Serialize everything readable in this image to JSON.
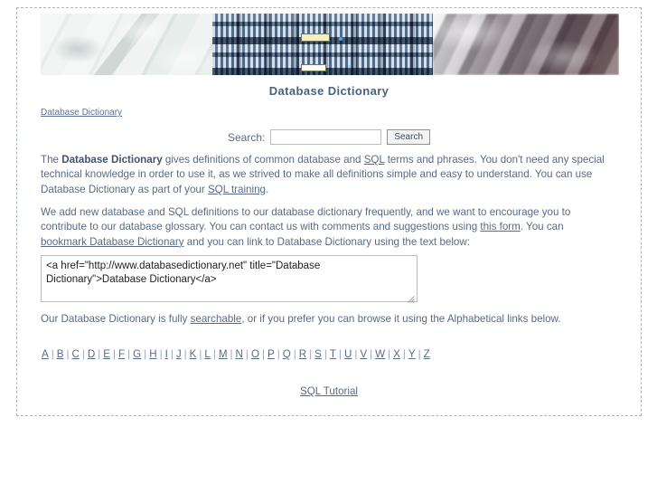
{
  "page": {
    "title": "Database Dictionary",
    "breadcrumb_label": "Database Dictionary"
  },
  "banner": {
    "images": [
      {
        "name": "keyboard-light-photo",
        "alt": "Light computer keyboard keys"
      },
      {
        "name": "server-racks-photo",
        "alt": "Blue server racks"
      },
      {
        "name": "keyboard-dark-photo",
        "alt": "Dark blurred keyboard"
      }
    ]
  },
  "search": {
    "label": "Search:",
    "value": "",
    "placeholder": "",
    "button_label": "Search"
  },
  "paragraph1": {
    "t1": "The ",
    "strong": "Database Dictionary",
    "t2": " gives definitions of common database and ",
    "link_sql": "SQL",
    "t3": " terms and phrases. You don't need any special technical knowledge in order to use it, as we strived to make all definitions simple and easy to understand. You can use Database Dictionary as part of your ",
    "link_sql_training": "SQL training",
    "t4": "."
  },
  "paragraph2": {
    "t1": "We add new database and SQL definitions to our database dictionary frequently, and we want to encourage you to contribute to our database glossary. You can contact us with comments and suggestions using ",
    "link_form": "this form",
    "t2": ". You can ",
    "link_bookmark": "bookmark Database Dictionary",
    "t3": " and you can link to Database Dictionary using the text below:"
  },
  "link_code": {
    "value": "<a href=\"http://www.databasedictionary.net\" title=\"Database Dictionary\">Database Dictionary</a>"
  },
  "paragraph3": {
    "t1": "Our Database Dictionary is fully ",
    "link_searchable": "searchable",
    "t2": ", or if you prefer you can browse it using the Alphabetical links below."
  },
  "alphabet": {
    "separator": "|",
    "letters": [
      "A",
      "B",
      "C",
      "D",
      "E",
      "F",
      "G",
      "H",
      "I",
      "J",
      "K",
      "L",
      "M",
      "N",
      "O",
      "P",
      "Q",
      "R",
      "S",
      "T",
      "U",
      "V",
      "W",
      "X",
      "Y",
      "Z"
    ]
  },
  "footer": {
    "link_label": "SQL Tutorial"
  },
  "colors": {
    "text": "#5a6a85",
    "title": "#49607f",
    "link": "#5a6a85",
    "border_dashed": "#a9b4c6",
    "background": "#ffffff"
  }
}
